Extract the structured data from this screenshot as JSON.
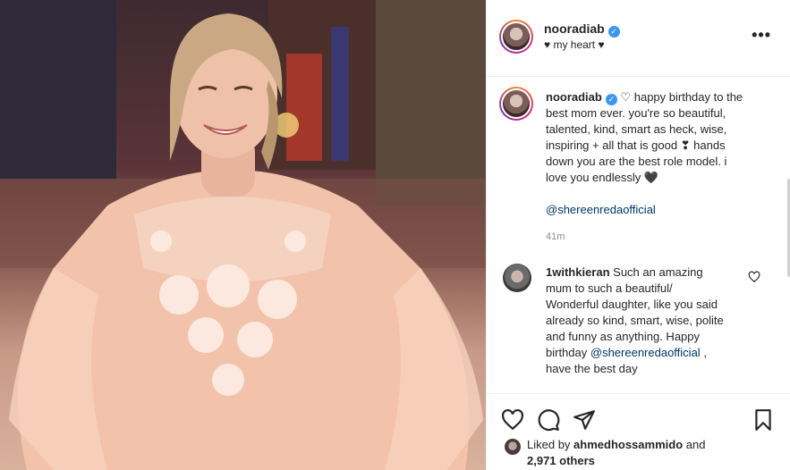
{
  "post": {
    "username": "nooradiab",
    "subtitle": "♥ my heart ♥",
    "more_label": "•••",
    "caption": {
      "username": "nooradiab",
      "text_line1": "♡ happy birthday to the",
      "text_lines": [
        "best mom ever. you're so beautiful,",
        "talented, kind, smart as heck, wise,",
        "inspiring + all that is good ❣ hands",
        "down you are the best role model. i",
        "love you endlessly 🖤"
      ],
      "mention": "@shereenredaofficial",
      "time": "41m"
    },
    "comment": {
      "username": "1withkieran",
      "text_line1": "Such an amazing",
      "text_lines": [
        "mum to such a beautiful/",
        "Wonderful daughter, like you said",
        "already so kind, smart, wise, polite",
        "and funny as anything. Happy"
      ],
      "pre_mention": "birthday",
      "mention": "@shereenredaofficial",
      "post_mention": ",",
      "last_line": "have the best day"
    },
    "likes": {
      "prefix": "Liked by",
      "user": "ahmedhossammido",
      "and": "and",
      "others": "2,971 others"
    }
  },
  "icons": {
    "like": "heart-icon",
    "comment": "comment-icon",
    "share": "paper-plane-icon",
    "save": "bookmark-icon",
    "verified": "verified-badge-icon",
    "comment_like": "heart-icon"
  },
  "colors": {
    "verified": "#3897f0",
    "mention": "#00376b",
    "muted": "#8e8e8e",
    "text": "#262626"
  }
}
